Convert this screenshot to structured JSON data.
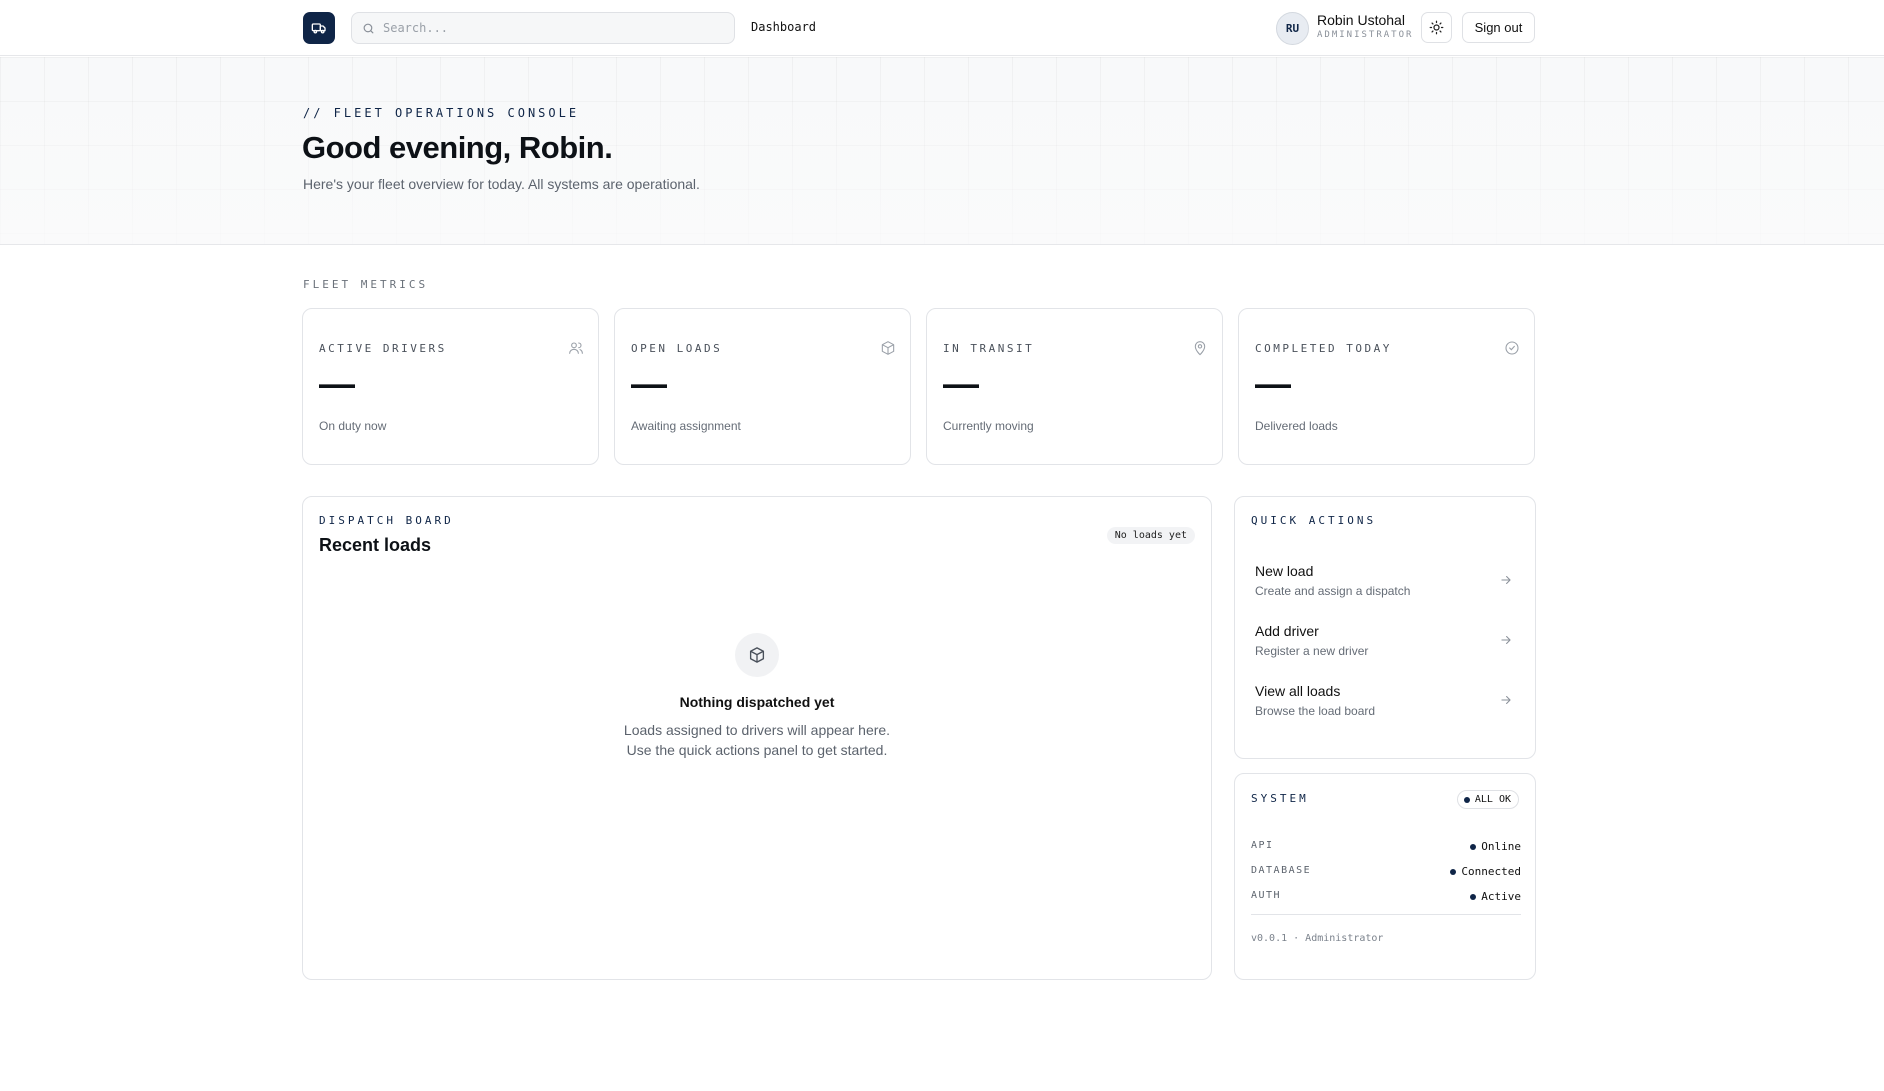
{
  "header": {
    "search_placeholder": "Search...",
    "nav_dashboard": "Dashboard",
    "user_initials": "RU",
    "user_name": "Robin Ustohal",
    "user_role": "ADMINISTRATOR",
    "sign_out": "Sign out"
  },
  "hero": {
    "eyebrow": "// FLEET OPERATIONS CONSOLE",
    "greeting": "Good evening, Robin.",
    "subtitle": "Here's your fleet overview for today. All systems are operational."
  },
  "metrics": {
    "section_label": "FLEET METRICS",
    "cards": [
      {
        "label": "ACTIVE DRIVERS",
        "value": "—",
        "sub": "On duty now",
        "icon": "users-icon"
      },
      {
        "label": "OPEN LOADS",
        "value": "—",
        "sub": "Awaiting assignment",
        "icon": "package-icon"
      },
      {
        "label": "IN TRANSIT",
        "value": "—",
        "sub": "Currently moving",
        "icon": "map-pin-icon"
      },
      {
        "label": "COMPLETED TODAY",
        "value": "—",
        "sub": "Delivered loads",
        "icon": "check-circle-icon"
      }
    ]
  },
  "dispatch": {
    "eyebrow": "DISPATCH BOARD",
    "title": "Recent loads",
    "badge": "No loads yet",
    "empty_title": "Nothing dispatched yet",
    "empty_line1": "Loads assigned to drivers will appear here.",
    "empty_line2": "Use the quick actions panel to get started."
  },
  "quick_actions": {
    "eyebrow": "QUICK ACTIONS",
    "items": [
      {
        "title": "New load",
        "sub": "Create and assign a dispatch"
      },
      {
        "title": "Add driver",
        "sub": "Register a new driver"
      },
      {
        "title": "View all loads",
        "sub": "Browse the load board"
      }
    ]
  },
  "system": {
    "eyebrow": "SYSTEM",
    "badge": "ALL OK",
    "rows": [
      {
        "key": "API",
        "value": "Online"
      },
      {
        "key": "DATABASE",
        "value": "Connected"
      },
      {
        "key": "AUTH",
        "value": "Active"
      }
    ],
    "version": "v0.0.1 · Administrator"
  },
  "colors": {
    "accent": "#0f2547",
    "border": "#e2e4e8",
    "muted_text": "#656c76"
  }
}
